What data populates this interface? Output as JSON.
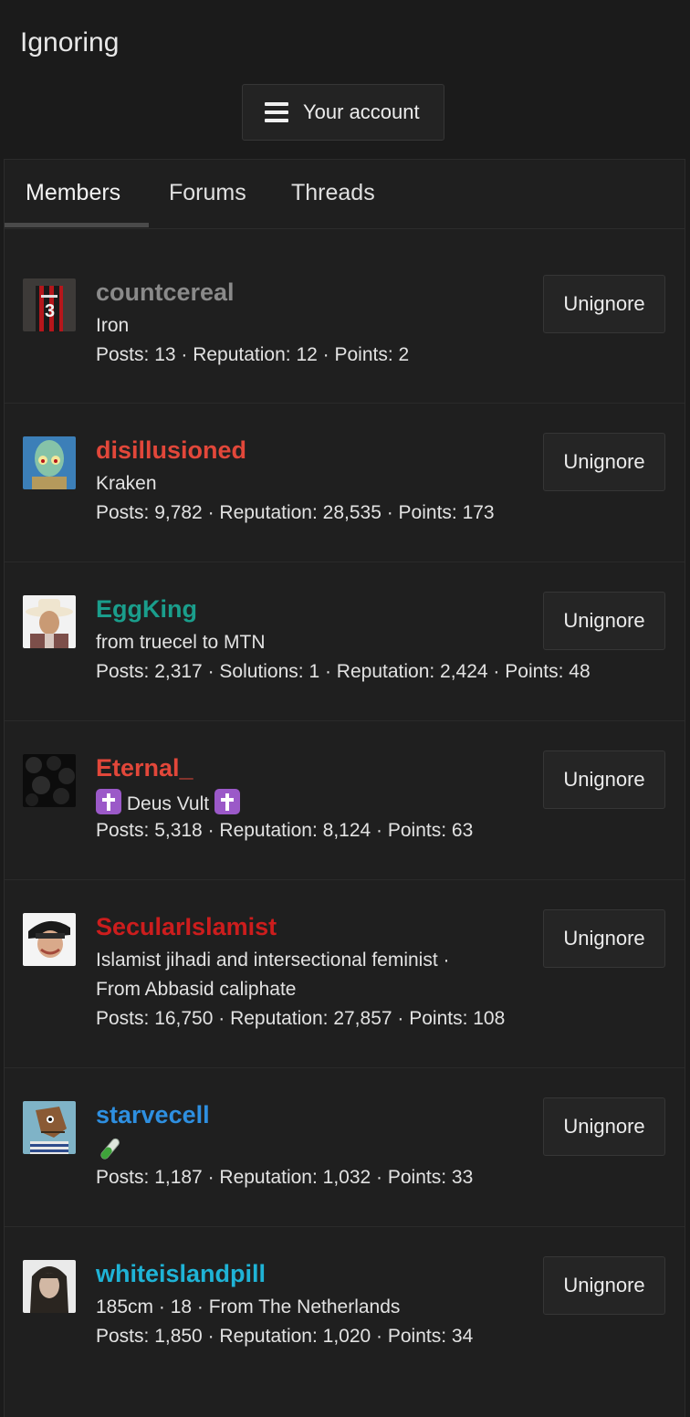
{
  "page": {
    "title": "Ignoring"
  },
  "account_button": {
    "label": "Your account",
    "icon": "hamburger-menu-icon"
  },
  "tabs": [
    {
      "label": "Members",
      "active": true
    },
    {
      "label": "Forums",
      "active": false
    },
    {
      "label": "Threads",
      "active": false
    }
  ],
  "unignore_label": "Unignore",
  "members": [
    {
      "username": "countcereal",
      "color": "#8a8a8a",
      "title": "Iron",
      "title_line2": "",
      "stats": "Posts: 13 · Reputation: 12 · Points: 2"
    },
    {
      "username": "disillusioned",
      "color": "#e2473a",
      "title": "Kraken",
      "title_line2": "",
      "stats": "Posts: 9,782 · Reputation: 28,535 · Points: 173"
    },
    {
      "username": "EggKing",
      "color": "#1a9e8c",
      "title": "from truecel to MTN",
      "title_line2": "",
      "stats": "Posts: 2,317 · Solutions: 1 · Reputation: 2,424 · Points: 48"
    },
    {
      "username": "Eternal_",
      "color": "#e2473a",
      "title": "Deus Vult",
      "title_line2": "",
      "stats": "Posts: 5,318 · Reputation: 8,124 · Points: 63"
    },
    {
      "username": "SecularIslamist",
      "color": "#cc1d1d",
      "title": "Islamist jihadi and intersectional feminist ·",
      "title_line2": "From Abbasid caliphate",
      "stats": "Posts: 16,750 · Reputation: 27,857 · Points: 108"
    },
    {
      "username": "starvecell",
      "color": "#2e8fe0",
      "title": "",
      "title_line2": "",
      "stats": "Posts: 1,187 · Reputation: 1,032 · Points: 33"
    },
    {
      "username": "whiteislandpill",
      "color": "#1fb3d6",
      "title": "185cm · 18 · From The Netherlands",
      "title_line2": "",
      "stats": "Posts: 1,850 · Reputation: 1,020 · Points: 34"
    }
  ]
}
